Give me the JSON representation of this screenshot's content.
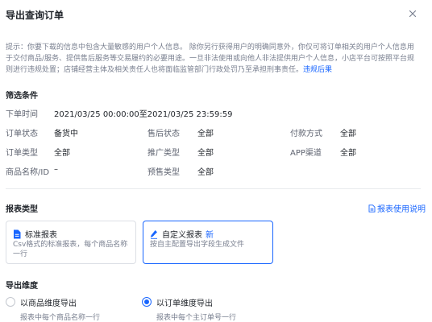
{
  "dialog": {
    "title": "导出查询订单",
    "close_icon": "close-icon"
  },
  "notice": {
    "text": "提示：你要下载的信息中包含大量敏感的用户个人信息。 除你另行获得用户的明确同意外，你仅可将订单相关的用户个人信息用于交付商品/服务、提供售后服务等交易履约的必要用途。一旦非法使用或向他人非法提供用户个人信息，小店平台可按照平台规则进行违规处置；店铺经营主体及相关责任人也将面临监管部门行政处罚乃至承担刑事责任。",
    "link": "违规后果"
  },
  "filters": {
    "title": "筛选条件",
    "order_time": {
      "label": "下单时间",
      "value": "2021/03/25 00:00:00至2021/03/25 23:59:59"
    },
    "order_status": {
      "label": "订单状态",
      "value": "备货中"
    },
    "after_sale_status": {
      "label": "售后状态",
      "value": "全部"
    },
    "payment_method": {
      "label": "付款方式",
      "value": "全部"
    },
    "order_type": {
      "label": "订单类型",
      "value": "全部"
    },
    "promotion_type": {
      "label": "推广类型",
      "value": "全部"
    },
    "app_channel": {
      "label": "APP渠道",
      "value": "全部"
    },
    "product_name": {
      "label": "商品名称/ID",
      "value": "–"
    },
    "presale_type": {
      "label": "预售类型",
      "value": "全部"
    }
  },
  "report_type": {
    "title": "报表类型",
    "help_link": "报表使用说明",
    "help_icon": "document-icon",
    "cards": [
      {
        "icon": "file-icon",
        "title": "标准报表",
        "badge": "",
        "desc": "Csv格式的标准报表，每个商品名称一行",
        "selected": false
      },
      {
        "icon": "pen-icon",
        "title": "自定义报表",
        "badge": "新",
        "desc": "按自主配置导出字段生成文件",
        "selected": true
      }
    ]
  },
  "export_dimension": {
    "title": "导出维度",
    "options": [
      {
        "label": "以商品维度导出",
        "desc": "报表中每个商品名称一行",
        "checked": false
      },
      {
        "label": "以订单维度导出",
        "desc": "报表中每个主订单号一行",
        "checked": true
      }
    ]
  },
  "colors": {
    "accent": "#1966ff",
    "text": "#1f2329",
    "muted": "#7a8090",
    "border": "#dcdfe5"
  }
}
